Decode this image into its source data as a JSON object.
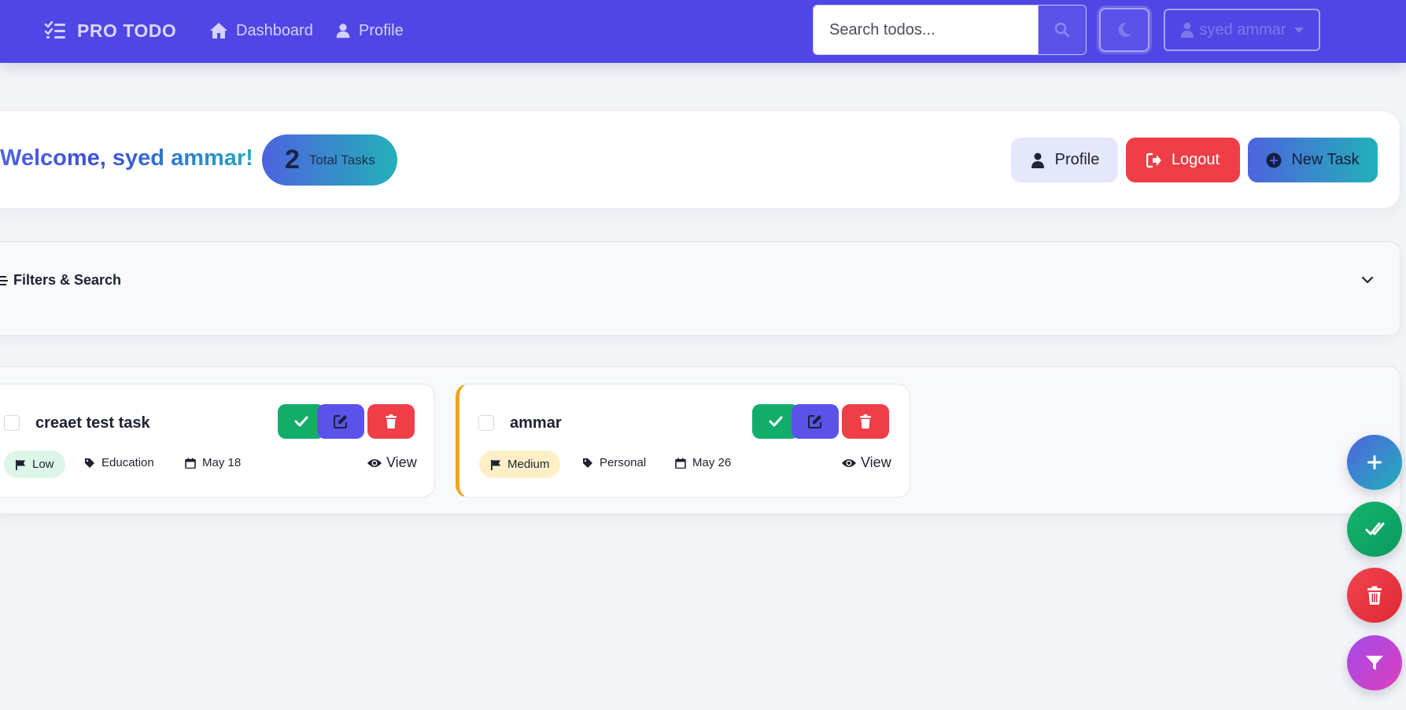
{
  "navbar": {
    "brand": "PRO TODO",
    "links": {
      "dashboard": "Dashboard",
      "profile": "Profile"
    },
    "search_placeholder": "Search todos...",
    "user_name": "syed ammar"
  },
  "welcome": {
    "greeting": "Welcome, ",
    "name": "syed ammar!",
    "total_count": "2",
    "total_label": "Total Tasks",
    "buttons": {
      "profile": "Profile",
      "logout": "Logout",
      "new_task": "New Task"
    }
  },
  "filters": {
    "title": "Filters & Search"
  },
  "tasks": [
    {
      "title": "creaet test task",
      "priority": "Low",
      "category": "Education",
      "date": "May 18",
      "view": "View"
    },
    {
      "title": "ammar",
      "priority": "Medium",
      "category": "Personal",
      "date": "May 26",
      "view": "View"
    }
  ],
  "colors": {
    "primary": "#4f46e5",
    "success": "#13ad6b",
    "danger": "#ef3e47",
    "medium_accent": "#f0a41e"
  }
}
